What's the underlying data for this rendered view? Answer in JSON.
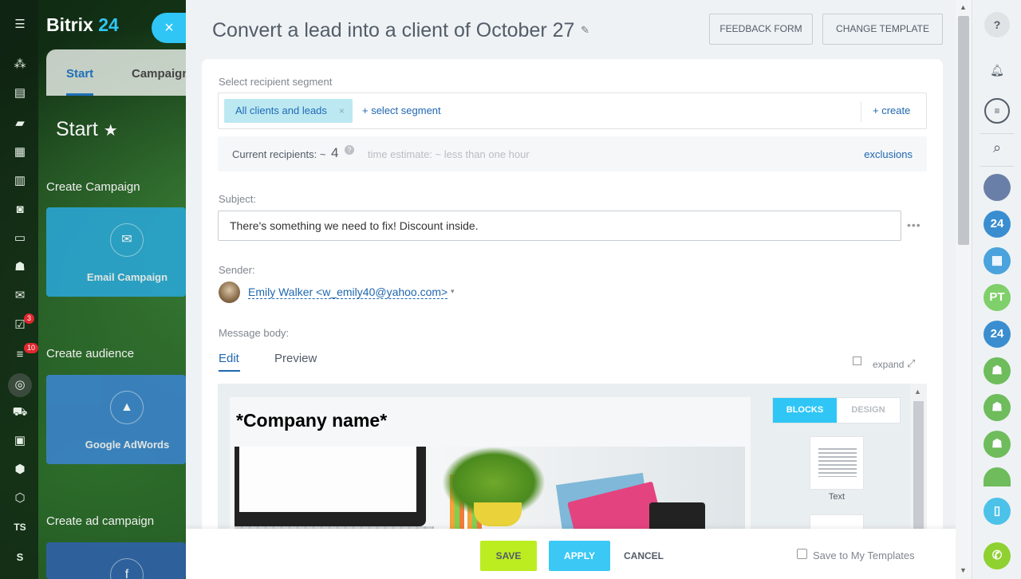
{
  "app": {
    "logo_text": "Bitrix",
    "logo_num": "24",
    "close_icon": "×"
  },
  "left_panel": {
    "tabs": [
      {
        "label": "Start"
      },
      {
        "label": "Campaign"
      }
    ],
    "page_title": "Start",
    "sections": [
      {
        "title": "Create Campaign",
        "tile": "Email Campaign",
        "tile_color": "#2aa4cf",
        "icon": "email-icon"
      },
      {
        "title": "Create audience",
        "tile": "Google AdWords",
        "tile_color": "#3b83c8",
        "icon": "adwords-icon"
      },
      {
        "title": "Create ad campaign",
        "tile": "",
        "tile_color": "#2f62a6",
        "icon": "facebook-icon"
      }
    ],
    "badges": {
      "tasks": "3",
      "feed": "10"
    },
    "bar_text": {
      "ts": "TS",
      "s": "S"
    }
  },
  "header": {
    "title": "Convert a lead into a client of October 27",
    "feedback_button": "FEEDBACK FORM",
    "change_template_button": "CHANGE TEMPLATE"
  },
  "segment": {
    "label": "Select recipient segment",
    "chip": "All clients and leads",
    "chip_remove": "×",
    "select_link": "+ select segment",
    "create_link": "+ create"
  },
  "recipients": {
    "text": "Current recipients: ~",
    "count": "4",
    "help": "?",
    "time_estimate": "time estimate: ~ less than one hour",
    "exclusions": "exclusions"
  },
  "subject": {
    "label": "Subject:",
    "value": "There's something we need to fix! Discount inside.",
    "more": "•••"
  },
  "sender": {
    "label": "Sender:",
    "value": "Emily Walker <w_emily40@yahoo.com>",
    "caret": "▾"
  },
  "message": {
    "label": "Message body:",
    "tab_edit": "Edit",
    "tab_preview": "Preview",
    "expand": "expand",
    "company": "*Company name*",
    "blocks_tab": "BLOCKS",
    "design_tab": "DESIGN",
    "block_text_label": "Text"
  },
  "footer": {
    "save": "SAVE",
    "apply": "APPLY",
    "cancel": "CANCEL",
    "save_template": "Save to My Templates"
  },
  "colors": {
    "accent": "#2fc6f6",
    "save_green": "#bbed21",
    "link_blue": "#2067b0"
  },
  "right_bar": {
    "help": "?",
    "avatars": [
      {
        "text": "",
        "color": "#6a7fa8",
        "icon": "user-photo-icon"
      },
      {
        "text": "24",
        "color": "#3a8ed0",
        "icon": "bitrix-24-icon"
      },
      {
        "text": "",
        "color": "#4aa3dc",
        "icon": "calendar-icon"
      },
      {
        "text": "PT",
        "color": "#7fcf6a",
        "icon": ""
      },
      {
        "text": "24",
        "color": "#3a8ed0",
        "icon": "bitrix-24-icon"
      },
      {
        "text": "",
        "color": "#6ebc5c",
        "icon": "group-icon"
      },
      {
        "text": "",
        "color": "#6ebc5c",
        "icon": "group-icon"
      },
      {
        "text": "",
        "color": "#6ebc5c",
        "icon": "group-icon"
      },
      {
        "text": "",
        "color": "#6ebc5c",
        "icon": "group-icon"
      }
    ]
  }
}
